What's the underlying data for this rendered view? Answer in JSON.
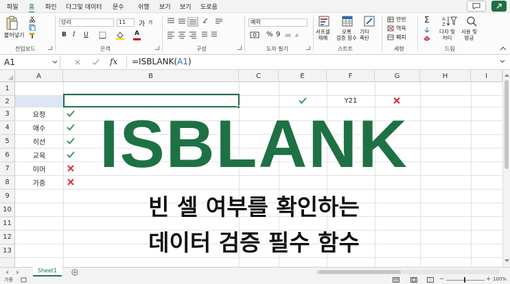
{
  "menu": [
    "파일",
    "홈",
    "파인",
    "다그및 데이터",
    "문수",
    "쉬행",
    "보기",
    "보기",
    "도로음"
  ],
  "menu_active_index": 1,
  "ribbon": {
    "clipboard": {
      "paste_label": "붙어넣기",
      "group": "전입보드"
    },
    "font": {
      "name": "당리",
      "size": "11",
      "bold": "B",
      "italic": "I",
      "underline": "U",
      "font_color_letter": "A",
      "grow": "가",
      "shrink": "가",
      "group": "은객",
      "font_color": "#c00000",
      "fill_color": "#ffd700"
    },
    "alignment": {
      "group": "구성"
    },
    "number": {
      "format": "예력",
      "percent": "%",
      "comma": "9",
      "group": "도자 필기"
    },
    "styles": {
      "conditional": "서프셀\n제예",
      "table": "모록\n검증 함수",
      "cell": "기티\n폭탄",
      "group": "스트트"
    },
    "cells": {
      "insert": "안반",
      "delete": "역옥",
      "format": "폐피",
      "group": "세형"
    },
    "editing": {
      "sum": "Σ",
      "sort": "다자 및\n처티",
      "find": "사용 및\n방긍",
      "group": "드림"
    }
  },
  "formula_bar": {
    "name_box": "A1",
    "fx": "fx",
    "formula_prefix": "=ISBLANK(",
    "formula_ref": "A1",
    "formula_suffix": ")"
  },
  "columns": [
    "A",
    "B",
    "C",
    "E",
    "F",
    "G",
    "H",
    "I"
  ],
  "rows": [
    "1",
    "2",
    "3",
    "4",
    "5",
    "6",
    "7",
    "8",
    "9",
    "10",
    "11",
    "12",
    "13"
  ],
  "cells": {
    "F2": "Y21",
    "E2": "check",
    "G2": "cross",
    "A": [
      "요정",
      "애수",
      "히선",
      "교육",
      "이머",
      "가증"
    ],
    "B": [
      "check",
      "check",
      "check",
      "check",
      "cross",
      "cross"
    ]
  },
  "overlay": {
    "title": "ISBLANK",
    "subtitle_line1": "빈 셀 여부를 확인하는",
    "subtitle_line2": "데이터 검증 필수 함수",
    "title_color": "#1e7145"
  },
  "sheet_tab": "Sheet1",
  "status": {
    "left": "가중",
    "zoom": "100%"
  },
  "colors": {
    "accent": "#1e7145",
    "check": "#2e8b57",
    "cross": "#d93025"
  }
}
